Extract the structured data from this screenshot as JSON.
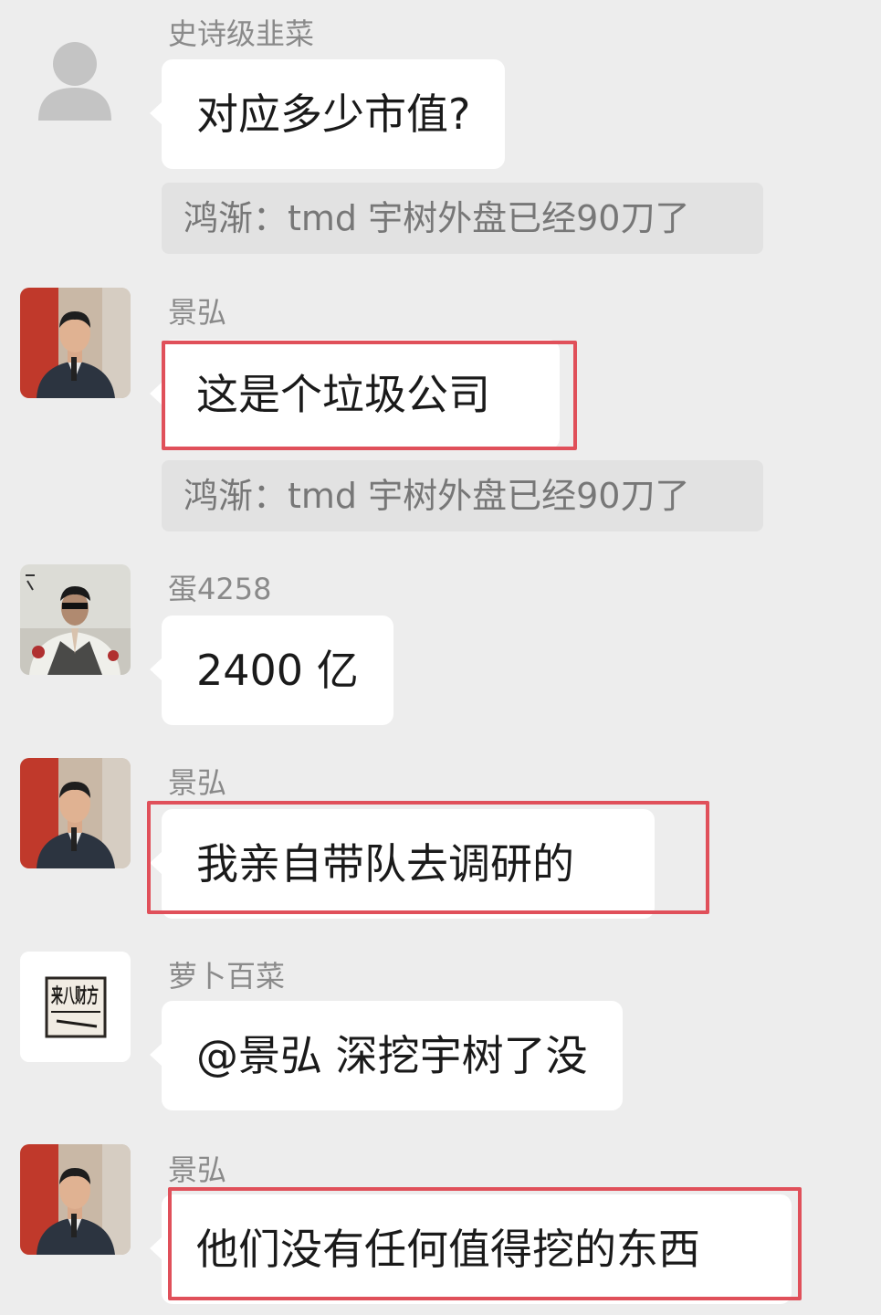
{
  "messages": [
    {
      "sender": "史诗级韭菜",
      "text": "对应多少市值?",
      "quote": "鸿渐：tmd 宇树外盘已经90刀了",
      "avatar_icon": "default-user-icon"
    },
    {
      "sender": "景弘",
      "text": "这是个垃圾公司",
      "quote": "鸿渐：tmd 宇树外盘已经90刀了",
      "highlighted": true,
      "avatar_icon": "man-speaking-photo"
    },
    {
      "sender": "蛋4258",
      "text": "2400 亿",
      "avatar_icon": "stylized-portrait"
    },
    {
      "sender": "景弘",
      "text": "我亲自带队去调研的",
      "highlighted": true,
      "avatar_icon": "man-speaking-photo"
    },
    {
      "sender": "萝卜百菜",
      "text": "@景弘  深挖宇树了没",
      "avatar_icon": "calligraphy-seal",
      "avatar_text": "来八财方"
    },
    {
      "sender": "景弘",
      "text": "他们没有任何值得挖的东西",
      "highlighted": true,
      "avatar_icon": "man-speaking-photo"
    }
  ],
  "colors": {
    "background": "#ededed",
    "bubble": "#ffffff",
    "quote_bg": "#e2e2e2",
    "highlight": "#e0505a"
  }
}
